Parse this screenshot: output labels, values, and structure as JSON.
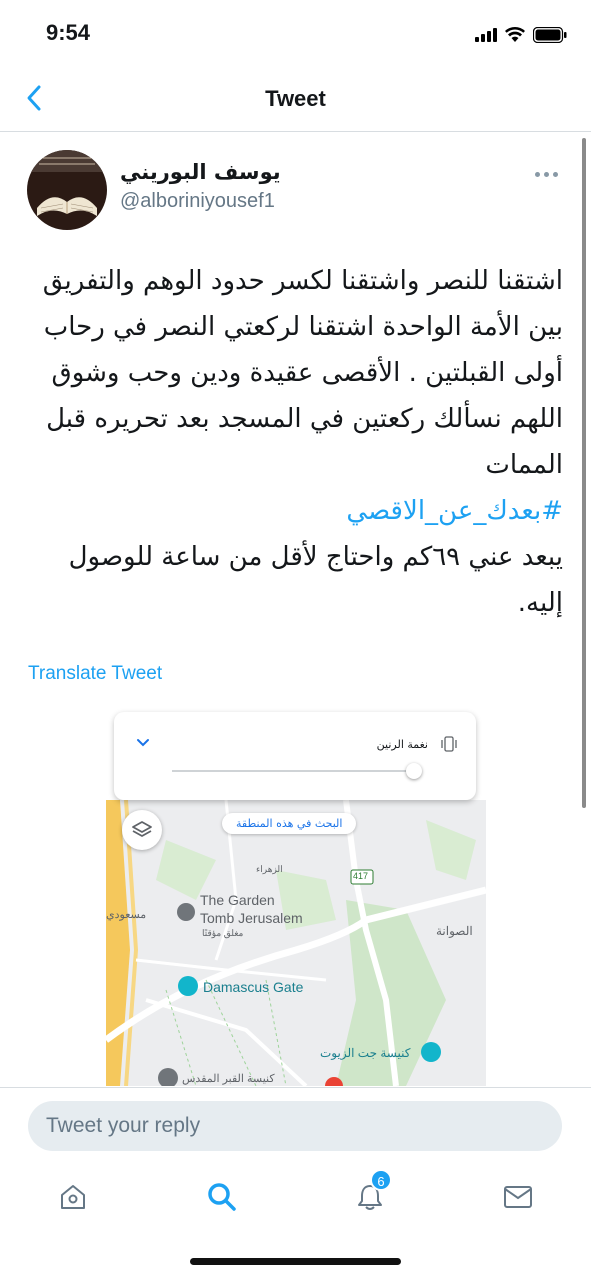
{
  "status_bar": {
    "time": "9:54"
  },
  "nav": {
    "title": "Tweet"
  },
  "tweet": {
    "author_name": "يوسف البوريني",
    "author_handle": "@alboriniyousef1",
    "text_main": "اشتقنا للنصر واشتقنا لكسر حدود الوهم والتفريق بين الأمة الواحدة اشتقنا لركعتي النصر في رحاب أولى القبلتين . الأقصى عقيدة ودين وحب وشوق اللهم نسألك ركعتين في المسجد بعد تحريره قبل الممات",
    "hashtag": "#بعدك_عن_الاقصي",
    "text_after": "يبعد عني ٦٩كم واحتاج لأقل من ساعة للوصول إليه.",
    "translate_label": "Translate Tweet"
  },
  "media": {
    "ringtone_label": "نغمة الرنين",
    "search_area_label": "البحث في هذه المنطقة",
    "map_labels": {
      "garden_tomb_1": "The Garden",
      "garden_tomb_2": "Tomb Jerusalem",
      "garden_tomb_status": "مغلق مؤقتًا",
      "damascus_gate": "Damascus Gate",
      "road_number": "417",
      "al_suwana": "الصوانة",
      "gethsemane": "كنيسة جت الزيوت",
      "holy_sepulchre": "كنيسة القبر المقدس",
      "zahra": "الزهراء",
      "masoudi": "مسعودي"
    }
  },
  "reply": {
    "placeholder": "Tweet your reply"
  },
  "tabs": {
    "notifications_badge": "6"
  },
  "colors": {
    "accent": "#1da1f2",
    "text": "#14171a",
    "secondary": "#657786"
  }
}
